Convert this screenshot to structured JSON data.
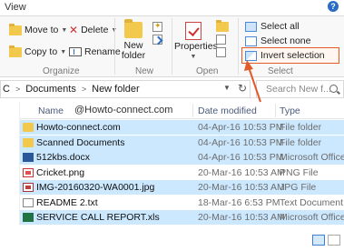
{
  "tabs": {
    "view": "View",
    "help": "?"
  },
  "ribbon": {
    "organize": {
      "label": "Organize",
      "move_to": "Move to",
      "copy_to": "Copy to",
      "delete": "Delete",
      "rename": "Rename"
    },
    "new": {
      "label": "New",
      "new_folder_line1": "New",
      "new_folder_line2": "folder"
    },
    "open": {
      "label": "Open",
      "properties": "Properties"
    },
    "select": {
      "label": "Select",
      "select_all": "Select all",
      "select_none": "Select none",
      "invert_selection": "Invert selection"
    }
  },
  "address": {
    "crumbs": [
      "C",
      "Documents",
      "New folder"
    ],
    "search_placeholder": "Search New f..."
  },
  "columns": {
    "name": "Name",
    "date": "Date modified",
    "type": "Type"
  },
  "watermark": "@Howto-connect.com",
  "files": [
    {
      "name": "Howto-connect.com",
      "date": "04-Apr-16 10:53 PM",
      "type": "File folder",
      "icon": "folder-icon",
      "selected": true
    },
    {
      "name": "Scanned Documents",
      "date": "04-Apr-16 10:53 PM",
      "type": "File folder",
      "icon": "folder-icon",
      "selected": true
    },
    {
      "name": "512kbs.docx",
      "date": "04-Apr-16 10:53 PM",
      "type": "Microsoft Office ...",
      "icon": "word-icon",
      "selected": true
    },
    {
      "name": "Cricket.png",
      "date": "20-Mar-16 10:53 AM",
      "type": "PNG File",
      "icon": "png-icon",
      "selected": false
    },
    {
      "name": "IMG-20160320-WA0001.jpg",
      "date": "20-Mar-16 10:53 AM",
      "type": "JPG File",
      "icon": "jpg-icon",
      "selected": true
    },
    {
      "name": "README 2.txt",
      "date": "18-Mar-16 6:53 PM",
      "type": "Text Document",
      "icon": "text-icon",
      "selected": false
    },
    {
      "name": "SERVICE  CALL REPORT.xls",
      "date": "20-Mar-16 10:53 AM",
      "type": "Microsoft Office ...",
      "icon": "excel-icon",
      "selected": true
    }
  ],
  "colors": {
    "selection": "#cce8ff",
    "accent": "#2a6cc4",
    "annotation": "#e05a2a"
  }
}
